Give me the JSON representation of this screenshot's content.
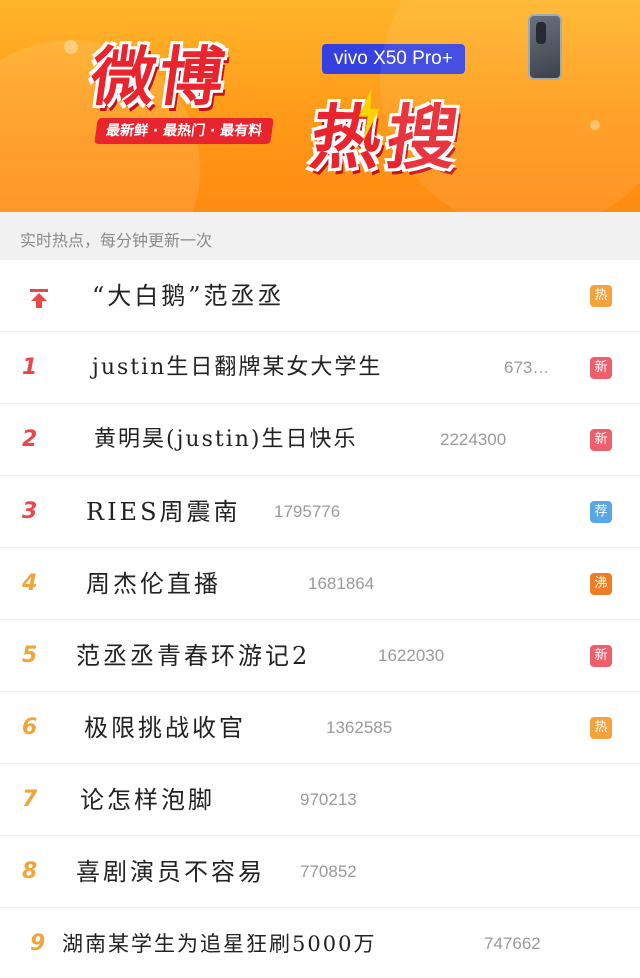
{
  "banner": {
    "title_line1": "微博",
    "title_line2": "热搜",
    "tagline": "最新鲜 · 最热门 · 最有料",
    "brand": "vivo X50 Pro+"
  },
  "subheader": "实时热点，每分钟更新一次",
  "colors": {
    "badge_hot": "#f4a23a",
    "badge_new": "#ee5f6b",
    "badge_recommend": "#59a6e9",
    "badge_boil": "#f07c25",
    "rank_top3": "#e8484a",
    "rank_other": "#f0a53a"
  },
  "rows": [
    {
      "rank": "",
      "rank_icon": "pin-top-icon",
      "title": "“大白鹅”范丞丞",
      "count": "",
      "badge": "热",
      "badge_type": "hot"
    },
    {
      "rank": "1",
      "title": "justin生日翻牌某女大学生",
      "count": "673…",
      "badge": "新",
      "badge_type": "new"
    },
    {
      "rank": "2",
      "title": "黄明昊(justin)生日快乐",
      "count": "2224300",
      "badge": "新",
      "badge_type": "new"
    },
    {
      "rank": "3",
      "title": "RIES周震南",
      "count": "1795776",
      "badge": "荐",
      "badge_type": "recommend"
    },
    {
      "rank": "4",
      "title": "周杰伦直播",
      "count": "1681864",
      "badge": "沸",
      "badge_type": "boil"
    },
    {
      "rank": "5",
      "title": "范丞丞青春环游记2",
      "count": "1622030",
      "badge": "新",
      "badge_type": "new"
    },
    {
      "rank": "6",
      "title": "极限挑战收官",
      "count": "1362585",
      "badge": "热",
      "badge_type": "hot"
    },
    {
      "rank": "7",
      "title": "论怎样泡脚",
      "count": "970213",
      "badge": "",
      "badge_type": ""
    },
    {
      "rank": "8",
      "title": "喜剧演员不容易",
      "count": "770852",
      "badge": "",
      "badge_type": ""
    },
    {
      "rank": "9",
      "title": "湖南某学生为追星狂刷5000万",
      "count": "747662",
      "badge": "",
      "badge_type": ""
    }
  ]
}
